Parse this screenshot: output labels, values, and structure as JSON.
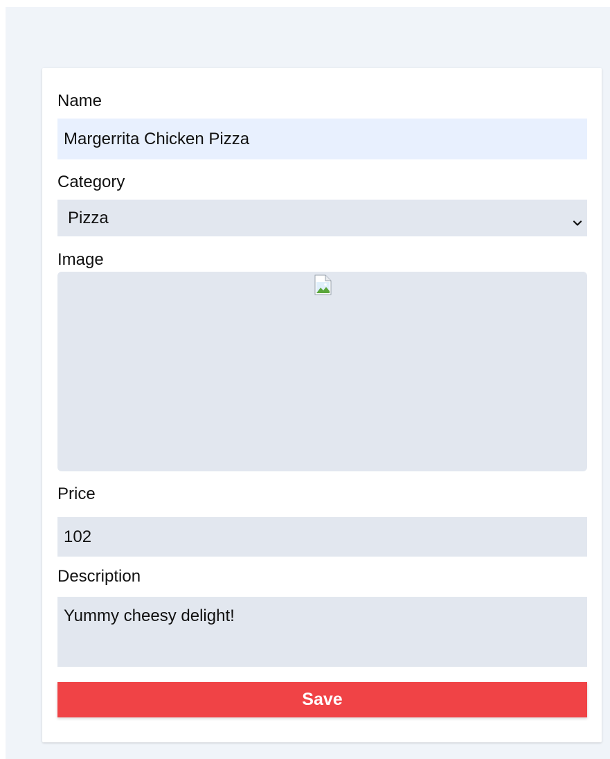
{
  "form": {
    "name_label": "Name",
    "name_value": "Margerrita Chicken Pizza",
    "category_label": "Category",
    "category_selected": "Pizza",
    "image_label": "Image",
    "price_label": "Price",
    "price_value": "102",
    "description_label": "Description",
    "description_value": "Yummy cheesy delight!",
    "save_label": "Save"
  },
  "icons": {
    "dropdown": "chevron-down-icon",
    "image_placeholder": "broken-image-icon"
  },
  "colors": {
    "page_background": "#f0f4f9",
    "card_background": "#ffffff",
    "autofill_input": "#e8f0fe",
    "input_background": "#e2e7ef",
    "save_button": "#f04346",
    "save_text": "#ffffff"
  }
}
